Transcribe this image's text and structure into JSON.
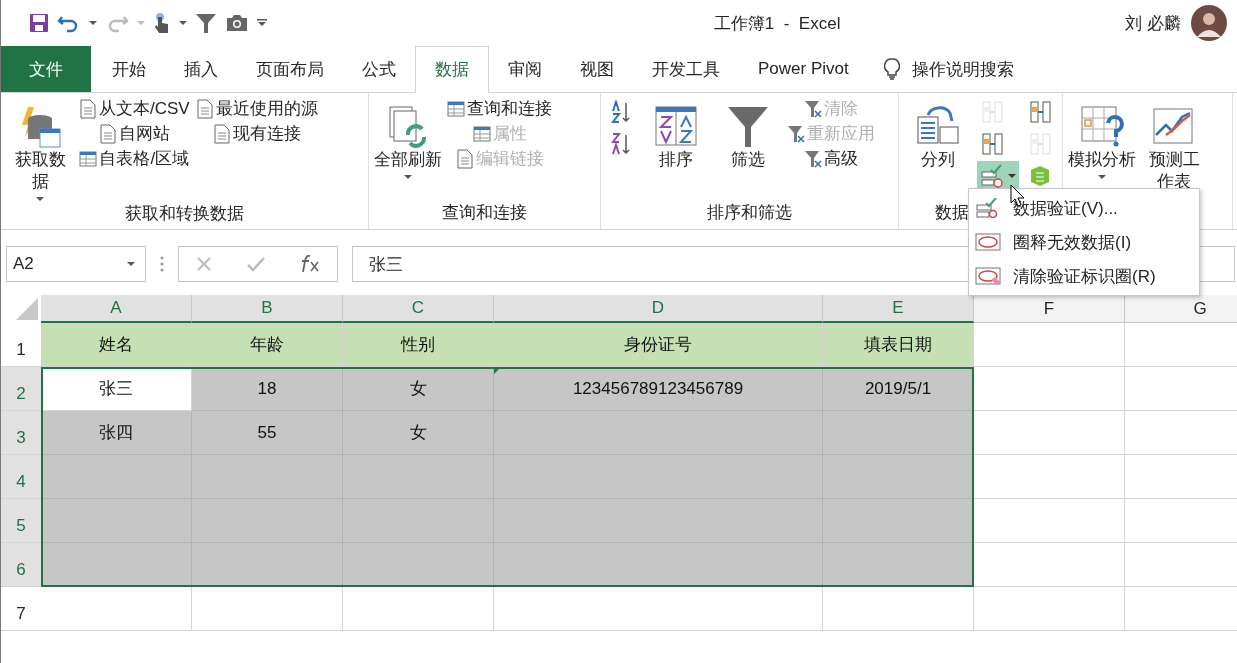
{
  "title_bar": {
    "title": "工作簿1  -  Excel",
    "user": "刘 必麟"
  },
  "tabs": [
    {
      "label": "文件",
      "kind": "file",
      "selected": false
    },
    {
      "label": "开始",
      "kind": "tab",
      "selected": false
    },
    {
      "label": "插入",
      "kind": "tab",
      "selected": false
    },
    {
      "label": "页面布局",
      "kind": "tab",
      "selected": false
    },
    {
      "label": "公式",
      "kind": "tab",
      "selected": false
    },
    {
      "label": "数据",
      "kind": "tab",
      "selected": true
    },
    {
      "label": "审阅",
      "kind": "tab",
      "selected": false
    },
    {
      "label": "视图",
      "kind": "tab",
      "selected": false
    },
    {
      "label": "开发工具",
      "kind": "tab",
      "selected": false
    },
    {
      "label": "Power Pivot",
      "kind": "tab",
      "selected": false
    },
    {
      "label": "操作说明搜索",
      "kind": "search"
    }
  ],
  "ribbon_groups": [
    {
      "label": "获取和转换数据",
      "columns": [
        [
          {
            "kind": "large",
            "label": "获取数据",
            "dropdown": true,
            "disabled": false
          }
        ],
        [
          {
            "kind": "small",
            "label": "从文本/CSV",
            "disabled": false
          },
          {
            "kind": "small",
            "label": "自网站",
            "disabled": false
          },
          {
            "kind": "small",
            "label": "自表格/区域",
            "disabled": false
          }
        ],
        [
          {
            "kind": "small",
            "label": "最近使用的源",
            "disabled": false
          },
          {
            "kind": "small",
            "label": "现有连接",
            "disabled": false
          }
        ]
      ]
    },
    {
      "label": "查询和连接",
      "columns": [
        [
          {
            "kind": "large",
            "label": "全部刷新",
            "dropdown": true,
            "disabled": false
          }
        ],
        [
          {
            "kind": "small",
            "label": "查询和连接",
            "disabled": false
          },
          {
            "kind": "small",
            "label": "属性",
            "disabled": true
          },
          {
            "kind": "small",
            "label": "编辑链接",
            "disabled": true
          }
        ]
      ]
    },
    {
      "label": "排序和筛选",
      "columns": [
        [
          {
            "kind": "icon",
            "disabled": false
          },
          {
            "kind": "icon",
            "disabled": false
          }
        ],
        [
          {
            "kind": "large",
            "label": "排序",
            "dropdown": false,
            "disabled": false
          }
        ],
        [
          {
            "kind": "large",
            "label": "筛选",
            "dropdown": false,
            "disabled": false
          }
        ],
        [
          {
            "kind": "small",
            "label": "清除",
            "disabled": true
          },
          {
            "kind": "small",
            "label": "重新应用",
            "disabled": true
          },
          {
            "kind": "small",
            "label": "高级",
            "disabled": false
          }
        ]
      ]
    },
    {
      "label": "数据",
      "columns": [
        [
          {
            "kind": "large",
            "label": "分列",
            "dropdown": false,
            "disabled": false
          }
        ],
        [
          {
            "kind": "icon",
            "disabled": true,
            "pressed": false
          },
          {
            "kind": "icon",
            "disabled": false,
            "pressed": false
          },
          {
            "kind": "icon",
            "disabled": false,
            "pressed": true,
            "dropdown": true
          }
        ],
        [
          {
            "kind": "icon",
            "disabled": false,
            "pressed": false
          },
          {
            "kind": "icon",
            "disabled": true,
            "pressed": false
          },
          {
            "kind": "icon",
            "disabled": false,
            "pressed": false
          }
        ]
      ]
    },
    {
      "columns": [
        [
          {
            "kind": "large",
            "label": "模拟分析",
            "dropdown": true,
            "disabled": false
          }
        ],
        [
          {
            "kind": "large",
            "label": "预测工作表",
            "dropdown": false,
            "disabled": false
          }
        ]
      ]
    }
  ],
  "formula_bar": {
    "name_box": "A2",
    "value": "张三"
  },
  "sheet": {
    "columns": [
      {
        "label": "A",
        "selected": true
      },
      {
        "label": "B",
        "selected": true
      },
      {
        "label": "C",
        "selected": true
      },
      {
        "label": "D",
        "selected": true
      },
      {
        "label": "E",
        "selected": true
      },
      {
        "label": "F",
        "selected": false
      },
      {
        "label": "G",
        "selected": false
      }
    ],
    "rows": [
      {
        "header": "1",
        "kind": "header",
        "selected": false,
        "cells": [
          {
            "text": "姓名",
            "active": false,
            "flag": false
          },
          {
            "text": "年龄",
            "active": false,
            "flag": false
          },
          {
            "text": "性别",
            "active": false,
            "flag": false
          },
          {
            "text": "身份证号",
            "active": false,
            "flag": false
          },
          {
            "text": "填表日期",
            "active": false,
            "flag": false
          }
        ]
      },
      {
        "header": "2",
        "kind": "data",
        "selected": true,
        "cells": [
          {
            "text": "张三",
            "active": true,
            "flag": false
          },
          {
            "text": "18",
            "active": false,
            "flag": false
          },
          {
            "text": "女",
            "active": false,
            "flag": false
          },
          {
            "text": "123456789123456789",
            "active": false,
            "flag": true
          },
          {
            "text": "2019/5/1",
            "active": false,
            "flag": false
          }
        ]
      },
      {
        "header": "3",
        "kind": "data",
        "selected": true,
        "cells": [
          {
            "text": "张四",
            "active": false,
            "flag": false
          },
          {
            "text": "55",
            "active": false,
            "flag": false
          },
          {
            "text": "女",
            "active": false,
            "flag": false
          }
        ]
      },
      {
        "header": "4",
        "kind": "data",
        "selected": true,
        "cells": []
      },
      {
        "header": "5",
        "kind": "data",
        "selected": true,
        "cells": []
      },
      {
        "header": "6",
        "kind": "data",
        "selected": true,
        "cells": []
      },
      {
        "header": "7",
        "kind": "data",
        "selected": false,
        "cells": []
      }
    ]
  },
  "dropdown_menu": [
    {
      "label": "数据验证(V)..."
    },
    {
      "label": "圈释无效数据(I)"
    },
    {
      "label": "清除验证标识圈(R)"
    }
  ]
}
